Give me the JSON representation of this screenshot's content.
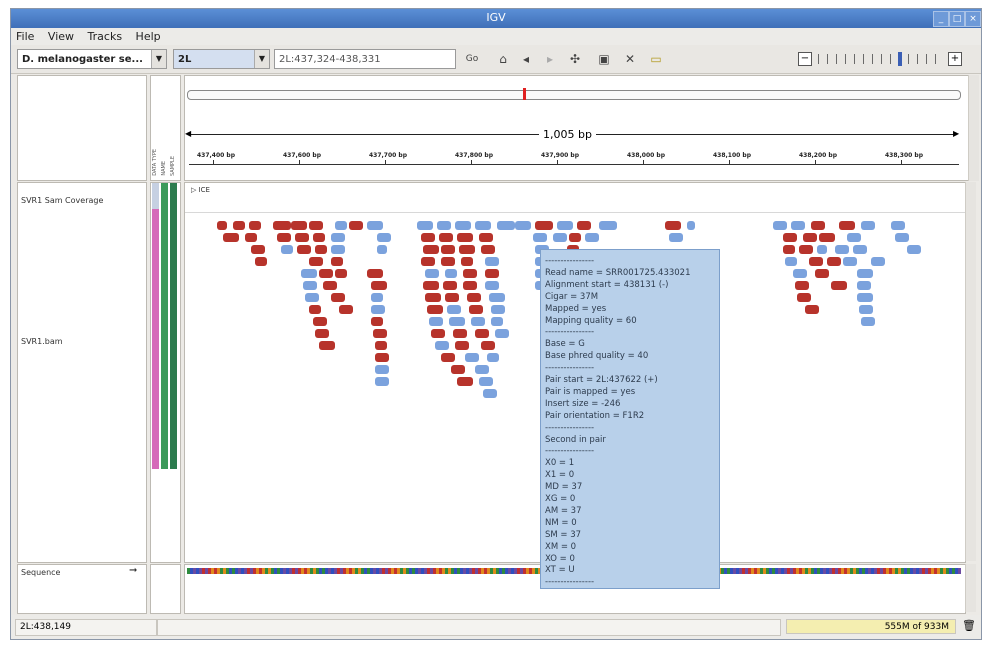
{
  "window": {
    "title": "IGV"
  },
  "menu": [
    "File",
    "View",
    "Tracks",
    "Help"
  ],
  "toolbar": {
    "genome": "D. melanogaster se...",
    "chromosome": "2L",
    "locus": "2L:437,324-438,331",
    "go": "Go"
  },
  "ruler": {
    "span": "1,005 bp",
    "ticks": [
      "437,400 bp",
      "437,600 bp",
      "437,700 bp",
      "437,800 bp",
      "437,900 bp",
      "438,000 bp",
      "438,100 bp",
      "438,200 bp",
      "438,300 bp"
    ]
  },
  "attribute_headers": [
    "DATA TYPE",
    "NAME",
    "SAMPLE"
  ],
  "tracks": {
    "coverage": "SVR1 Sam Coverage",
    "alignments": "SVR1.bam",
    "sequence": "Sequence",
    "alignment_marker": "▷ ICE"
  },
  "popup": {
    "lines": [
      "----------------",
      "Read name = SRR001725.433021",
      "Alignment start = 438131 (-)",
      "Cigar = 37M",
      "Mapped = yes",
      "Mapping quality = 60",
      "----------------",
      "Base = G",
      "Base phred quality = 40",
      "----------------",
      "Pair start = 2L:437622 (+)",
      "Pair is mapped = yes",
      "Insert size = -246",
      "Pair orientation = F1R2",
      "----------------",
      "Second in pair",
      "----------------",
      "X0 = 1",
      "X1 = 0",
      "MD = 37",
      "XG = 0",
      "AM = 37",
      "NM = 0",
      "SM = 37",
      "XM = 0",
      "XO = 0",
      "XT = U",
      "----------------"
    ]
  },
  "status": {
    "position": "2L:438,149",
    "memory": "555M of 933M"
  },
  "colors": {
    "forward": "#b7332b",
    "reverse": "#7ba2dd",
    "popup": "#b8d0ea"
  },
  "icons": [
    "home-icon",
    "back-icon",
    "forward-icon",
    "refresh-icon",
    "region-icon",
    "resize-icon",
    "popup-text-icon",
    "trash-icon"
  ]
}
